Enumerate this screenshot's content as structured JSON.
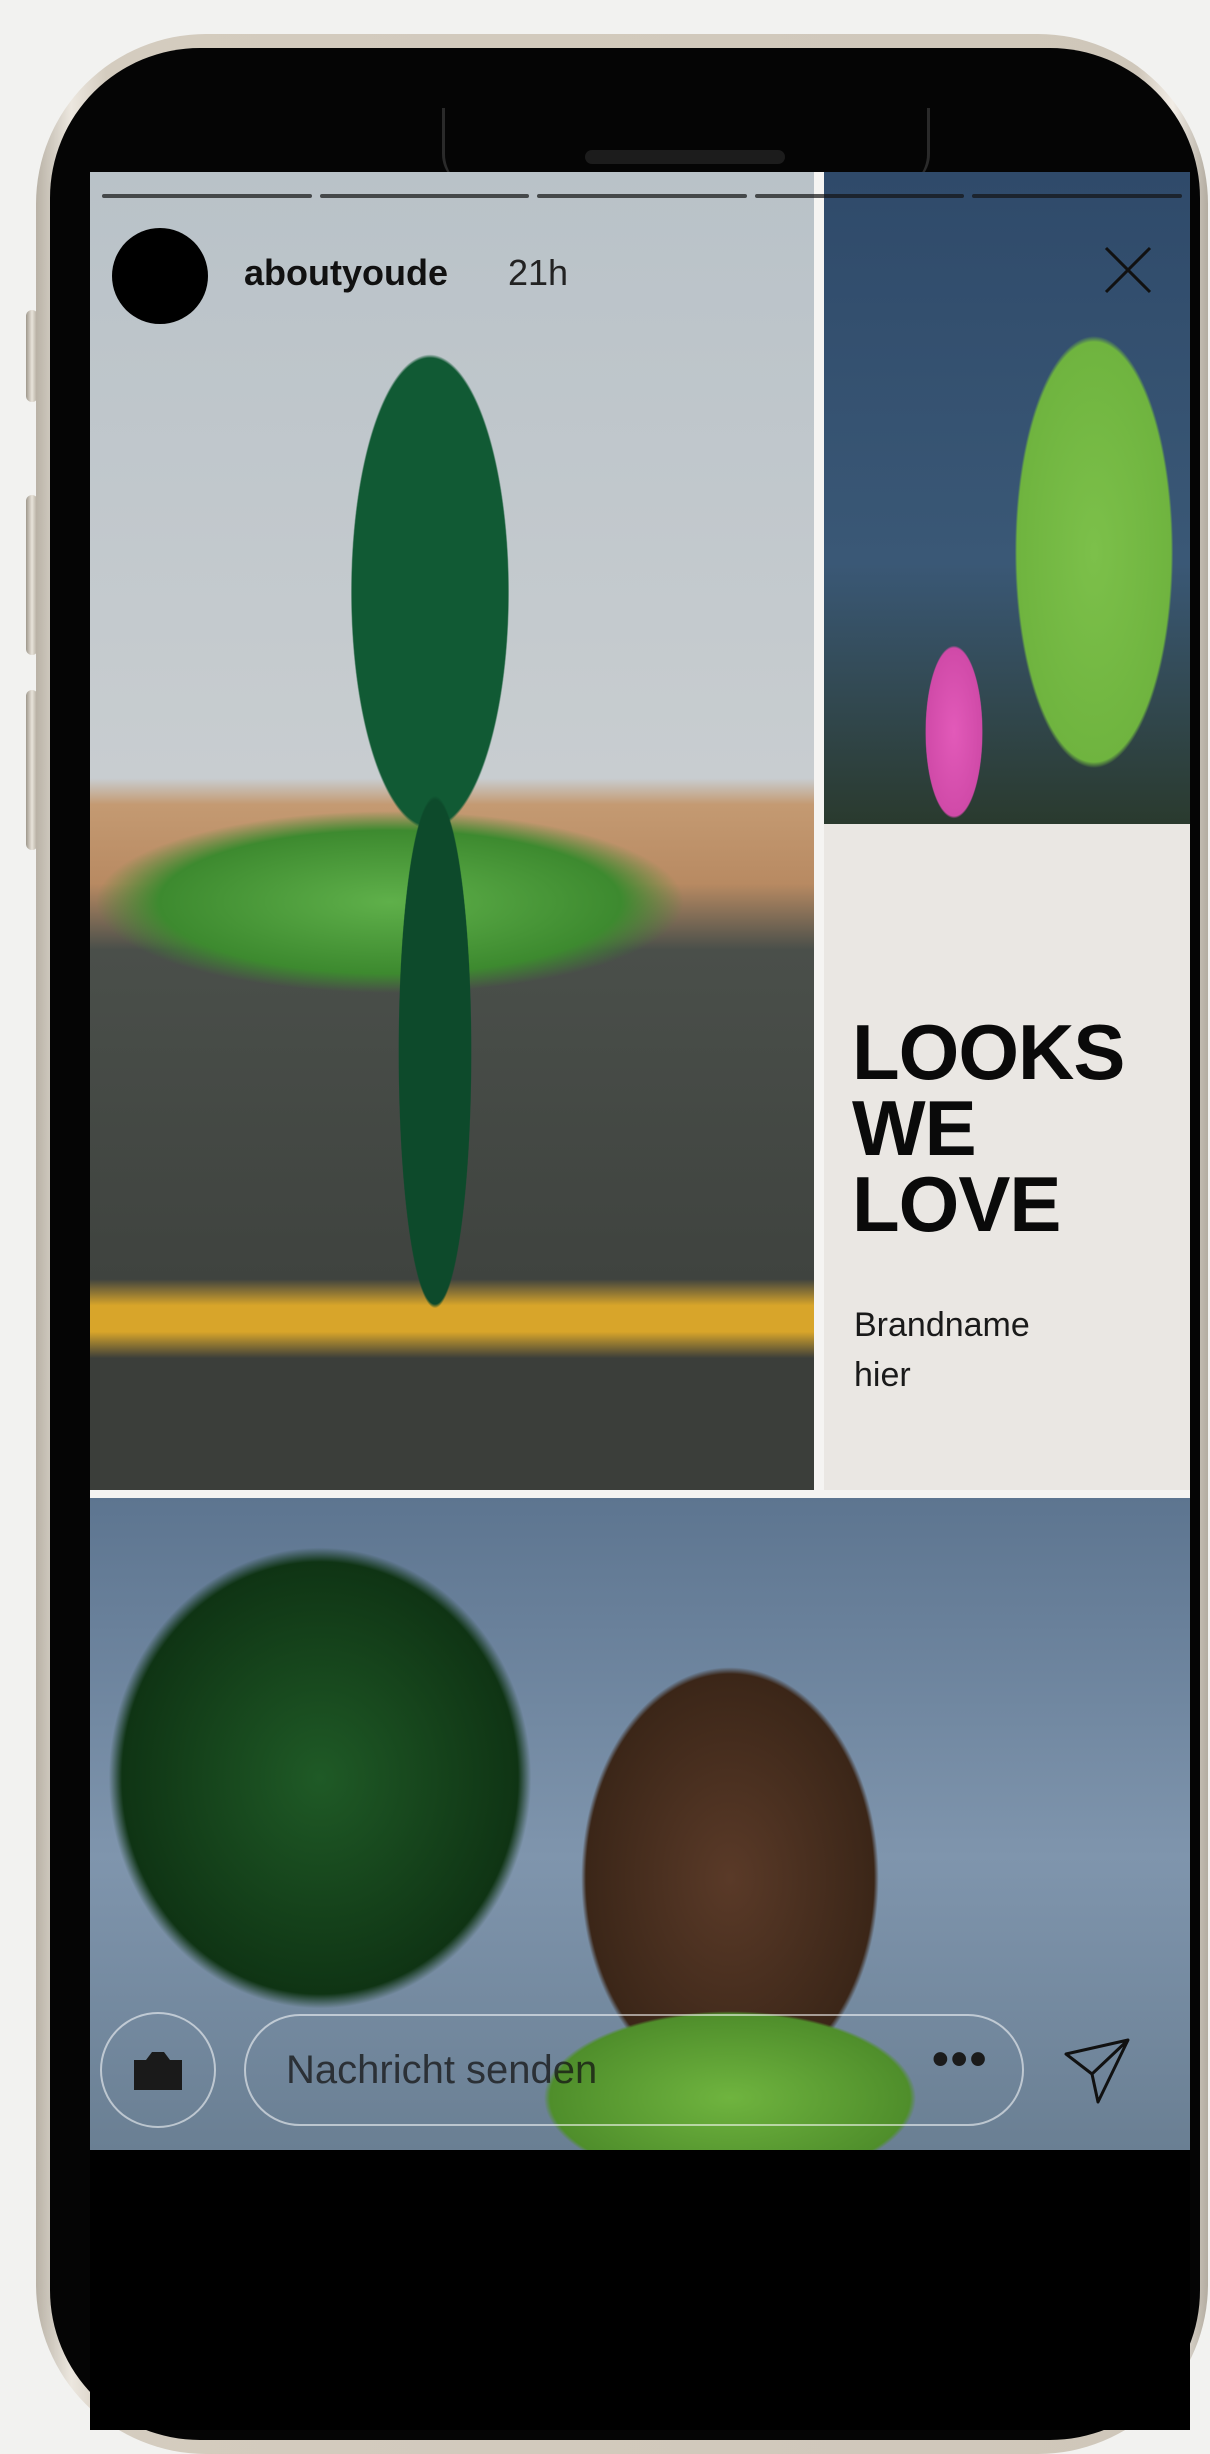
{
  "story": {
    "username": "aboutyoude",
    "time": "21h",
    "progress_segments": 5,
    "progress_done": 0
  },
  "panel": {
    "headline": "LOOKS\nWE\nLOVE",
    "subtext": "Brandname\nhier"
  },
  "reply_bar": {
    "placeholder": "Nachricht senden",
    "more_label": "•••"
  },
  "icons": [
    "close-icon",
    "camera-icon",
    "send-icon",
    "more-icon"
  ]
}
